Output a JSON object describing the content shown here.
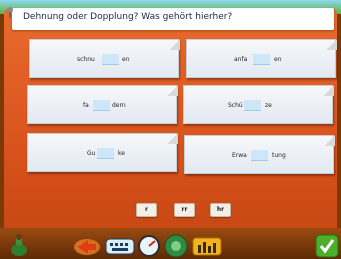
{
  "header": {
    "title": "Dehnung oder Dopplung? Was gehört hierher?"
  },
  "cards": [
    {
      "before": "schnu",
      "after": "en"
    },
    {
      "before": "anfa",
      "after": "en"
    },
    {
      "before": "fa",
      "after": "dern"
    },
    {
      "before": "Schü",
      "after": "ze"
    },
    {
      "before": "Gu",
      "after": "ke"
    },
    {
      "before": "Erwa",
      "after": "tung"
    }
  ],
  "choices": [
    "r",
    "rr",
    "hr"
  ],
  "toolbar": {
    "icons": [
      "potion-bottle-icon",
      "back-arrow-icon",
      "keyboard-icon",
      "speedometer-icon",
      "cd-player-icon",
      "equalizer-icon",
      "confirm-check-icon"
    ]
  },
  "colors": {
    "board": "#d9521c",
    "header": "#ffffff",
    "gap": "#cde7f8"
  }
}
